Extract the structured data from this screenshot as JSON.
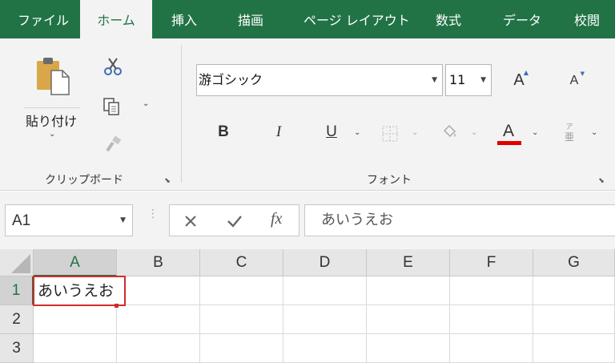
{
  "ribbon_tabs": [
    {
      "label": "ファイル"
    },
    {
      "label": "ホーム"
    },
    {
      "label": "挿入"
    },
    {
      "label": "描画"
    },
    {
      "label": "ページ レイアウト"
    },
    {
      "label": "数式"
    },
    {
      "label": "データ"
    },
    {
      "label": "校閲"
    }
  ],
  "active_tab": "ホーム",
  "clipboard": {
    "paste_label": "貼り付け",
    "group_label": "クリップボード",
    "icons": [
      "paste-icon",
      "cut-icon",
      "copy-icon",
      "format-painter-icon"
    ]
  },
  "font": {
    "group_label": "フォント",
    "font_name": "游ゴシック",
    "font_size": "11",
    "increase_size_glyph": "A",
    "decrease_size_glyph": "A",
    "bold_glyph": "B",
    "italic_glyph": "I",
    "underline_glyph": "U",
    "font_color_glyph": "A",
    "font_color": "#e00000",
    "phonetic_glyph_top": "ア",
    "phonetic_glyph_bottom": "亜"
  },
  "formula_bar": {
    "name_box": "A1",
    "fx_glyph": "fx",
    "value": "あいうえお"
  },
  "grid": {
    "columns": [
      "A",
      "B",
      "C",
      "D",
      "E",
      "F",
      "G"
    ],
    "rows": [
      "1",
      "2",
      "3"
    ],
    "cells": {
      "A1": "あいうえお"
    },
    "selected_cell": "A1"
  },
  "colors": {
    "accent": "#217346",
    "selection_border": "#d32b2b"
  }
}
